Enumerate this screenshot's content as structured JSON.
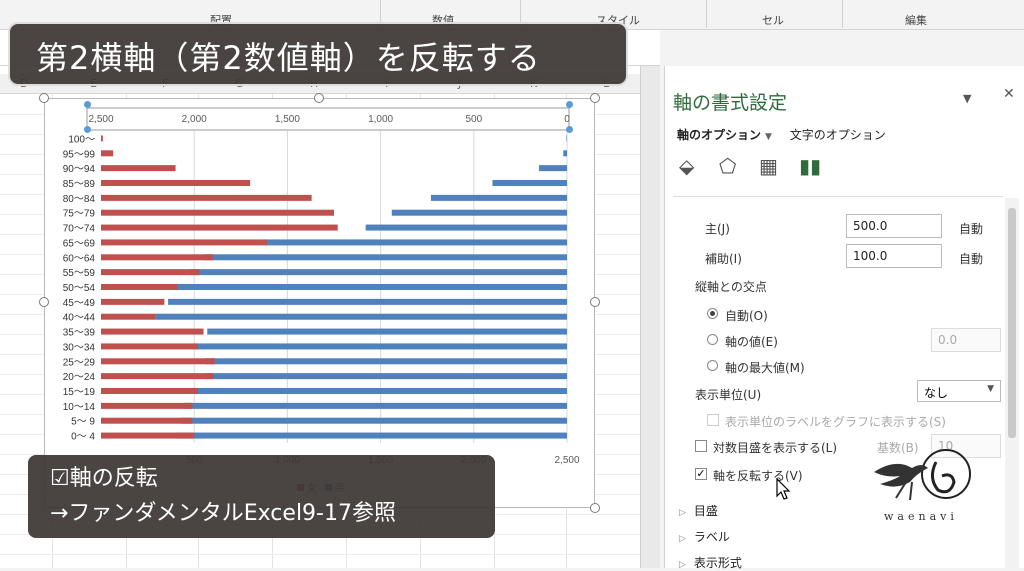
{
  "ribbon": {
    "groups": [
      "配置",
      "数値",
      "スタイル",
      "セル",
      "編集"
    ]
  },
  "sheet": {
    "columns": [
      "D",
      "E",
      "F",
      "G",
      "H",
      "I",
      "J",
      "K",
      "L"
    ]
  },
  "title_overlay": "第2横軸（第2数値軸）を反転する",
  "note": {
    "line1": "☑軸の反転",
    "line2": "→ファンダメンタルExcel9-17参照"
  },
  "pane": {
    "title": "軸の書式設定",
    "tab_axis": "軸のオプション",
    "tab_text": "文字のオプション",
    "major_label": "主(J)",
    "major_value": "500.0",
    "minor_label": "補助(I)",
    "minor_value": "100.0",
    "auto": "自動",
    "cross_label": "縦軸との交点",
    "radio_auto": "自動(O)",
    "radio_value": "軸の値(E)",
    "radio_value_input": "0.0",
    "radio_max": "軸の最大値(M)",
    "display_unit_label": "表示単位(U)",
    "display_unit_value": "なし",
    "show_unit_label": "表示単位のラベルをグラフに表示する(S)",
    "log_label": "対数目盛を表示する(L)",
    "log_base_label": "基数(B)",
    "log_base_value": "10",
    "reverse_label": "軸を反転する(V)",
    "reverse_checked": true,
    "section_ticks": "目盛",
    "section_labels": "ラベル",
    "section_format": "表示形式"
  },
  "logo_text": "waenavi",
  "colors": {
    "female": "#c0504d",
    "male": "#4f81bd",
    "pane_title": "#2f6b3c"
  },
  "chart_data": {
    "type": "bar",
    "orientation": "horizontal",
    "categories": [
      "100～",
      "95～99",
      "90～94",
      "85～89",
      "80～84",
      "75～79",
      "70～74",
      "65～69",
      "60～64",
      "55～59",
      "50～54",
      "45～49",
      "40～44",
      "35～39",
      "30～34",
      "25～29",
      "20～24",
      "15～19",
      "10～14",
      "5～ 9",
      "0～ 4"
    ],
    "series": [
      {
        "name": "女",
        "color": "#c0504d",
        "axis": "bottom",
        "values": [
          10,
          65,
          400,
          800,
          1130,
          1250,
          1270,
          890,
          600,
          530,
          410,
          340,
          290,
          550,
          520,
          610,
          600,
          520,
          490,
          490,
          500
        ]
      },
      {
        "name": "男",
        "color": "#4f81bd",
        "axis": "top-reversed",
        "values": [
          3,
          20,
          150,
          400,
          730,
          940,
          1080,
          1620,
          1950,
          2020,
          2110,
          2140,
          2210,
          1930,
          2000,
          1940,
          1940,
          2010,
          2050,
          2070,
          2100
        ]
      }
    ],
    "bottom_axis": {
      "ticks": [
        "500",
        "1,000",
        "1,500",
        "2,000",
        "2,500"
      ],
      "range": [
        0,
        2500
      ]
    },
    "top_axis": {
      "ticks": [
        "2,500",
        "2,000",
        "1,500",
        "1,000",
        "500",
        "0"
      ],
      "range": [
        0,
        2500
      ],
      "reversed": true
    },
    "legend": [
      "女",
      "男"
    ],
    "legend_position": "bottom",
    "grid": true
  }
}
